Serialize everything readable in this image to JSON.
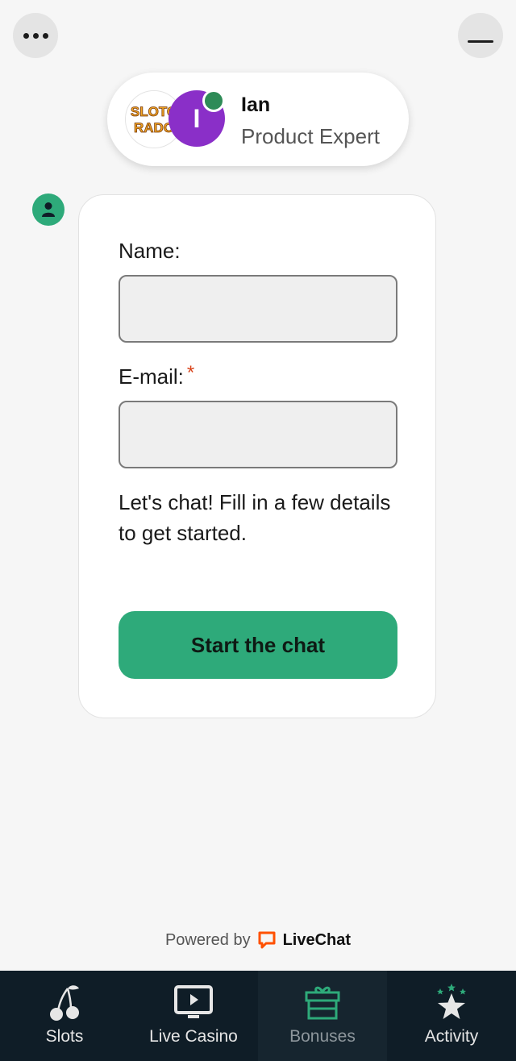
{
  "header": {
    "menu_icon": "more-dots-icon",
    "minimize_icon": "minimize-icon"
  },
  "agent": {
    "name": "Ian",
    "role": "Product Expert",
    "initial": "I",
    "brand_logo_text_line1": "SLOTO",
    "brand_logo_text_line2": "RADO",
    "status": "online",
    "status_color": "#2e8b57",
    "avatar_color": "#8a2fc8"
  },
  "form": {
    "name_label": "Name:",
    "name_value": "",
    "email_label": "E-mail:",
    "email_required_mark": "*",
    "email_value": "",
    "intro_text": "Let's chat! Fill in a few details to get started.",
    "submit_label": "Start the chat"
  },
  "footer": {
    "powered_by": "Powered by",
    "brand": "LiveChat",
    "brand_color": "#ff5100"
  },
  "nav": {
    "items": [
      {
        "label": "Slots",
        "icon": "cherries-icon"
      },
      {
        "label": "Live Casino",
        "icon": "tv-play-icon"
      },
      {
        "label": "Bonuses",
        "icon": "gift-icon"
      },
      {
        "label": "Activity",
        "icon": "star-icon"
      }
    ],
    "active": "Bonuses"
  },
  "colors": {
    "accent": "#2eaa7a",
    "nav_bg": "#0f1d27"
  }
}
